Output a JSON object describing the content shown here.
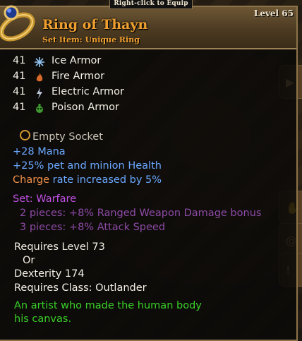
{
  "item": {
    "hint": "Right-click to Equip",
    "name": "Ring of Thayn",
    "subtitle": "Set Item: Unique Ring",
    "level": "Level 65"
  },
  "armors": [
    {
      "value": "41",
      "label": "Ice Armor",
      "icon": "ice-icon",
      "color": "#7fb0e0"
    },
    {
      "value": "41",
      "label": "Fire Armor",
      "icon": "fire-icon",
      "color": "#d86a2a"
    },
    {
      "value": "41",
      "label": "Electric Armor",
      "icon": "lightning-icon",
      "color": "#b9c4d6"
    },
    {
      "value": "41",
      "label": "Poison Armor",
      "icon": "poison-icon",
      "color": "#4caf3a"
    }
  ],
  "socket": "Empty Socket",
  "stats": {
    "mana": "+28 Mana",
    "health": "+25% pet and minion Health",
    "charge_word": "Charge",
    "charge_rest": " rate increased by 5%"
  },
  "set": {
    "name": "Set: Warfare",
    "bonus_2": "2 pieces: +8% Ranged Weapon Damage bonus",
    "bonus_3": "3 pieces: +8% Attack Speed"
  },
  "requirements": {
    "level": "Requires Level 73",
    "or": "Or",
    "dex": "Dexterity 174",
    "class": "Requires Class: Outlander"
  },
  "flavor": {
    "line1": "An artist who made the human body",
    "line2": "his canvas."
  },
  "colors": {
    "name": "#f0a030",
    "stat_blue": "#6aa8ff",
    "set_purple": "#c050e6",
    "flavor_green": "#39d029"
  }
}
